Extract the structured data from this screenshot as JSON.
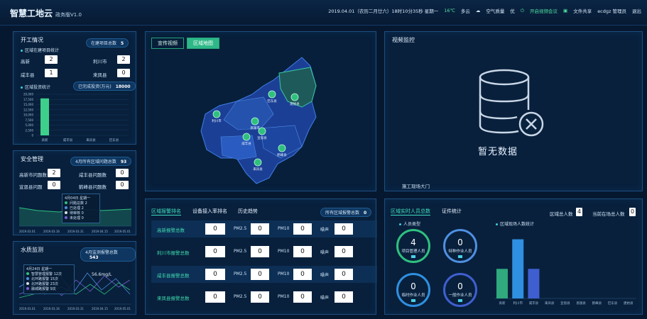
{
  "header": {
    "brand": "智慧工地云",
    "version": "政务版V1.0",
    "datetime": "2019.04.01（农历二月廿六）18时10分35秒 星期一",
    "temperature": "16℃",
    "weather": "多云",
    "air_label": "空气质量",
    "air_value": "优",
    "video_meeting": "开启视频会议",
    "file_share": "文件共享",
    "user": "ecdgz 管理员",
    "logout": "退出"
  },
  "kaigong": {
    "title": "开工情况",
    "badge_label": "在建项目总数",
    "badge_value": "5",
    "sub1": "区域在建项目统计",
    "items": [
      {
        "label": "高新",
        "value": "2"
      },
      {
        "label": "利川市",
        "value": "2"
      },
      {
        "label": "咸丰县",
        "value": "1"
      },
      {
        "label": "来凤县",
        "value": "0"
      }
    ],
    "sub2": "区域投资统计",
    "invest_label": "已完成投资(万元)",
    "invest_value": "18000"
  },
  "invest_chart": {
    "type": "bar",
    "categories": [
      "高新",
      "咸丰县",
      "来凤县",
      "巴东县"
    ],
    "values": [
      18000,
      0,
      0,
      0
    ],
    "ylim": [
      0,
      20000
    ],
    "yticks": [
      "20,000",
      "17,500",
      "15,000",
      "12,500",
      "10,000",
      "7,500",
      "5,000",
      "2,500",
      "0"
    ]
  },
  "safety": {
    "title": "安全管理",
    "badge_label": "4月所有区域问题总数",
    "badge_value": "93",
    "items": [
      {
        "label": "高新市问题数",
        "value": "2"
      },
      {
        "label": "咸丰县问题数",
        "value": "0"
      },
      {
        "label": "宣恩县问题",
        "value": "0"
      },
      {
        "label": "鹤峰县问题数",
        "value": "0"
      }
    ],
    "tooltip": {
      "title": "4月04日 星期一",
      "rows": [
        {
          "label": "问题总数",
          "value": "2",
          "color": "#2fc07e"
        },
        {
          "label": "已处理",
          "value": "2",
          "color": "#4f8fe0"
        },
        {
          "label": "待审核",
          "value": "0",
          "color": "#d8dbe6"
        },
        {
          "label": "未处理",
          "value": "0",
          "color": "#7a5fd8"
        }
      ]
    },
    "dates": [
      "2019.03.01",
      "2019.03.16",
      "2019.03.31",
      "2019.04.15",
      "2019.05.01"
    ]
  },
  "water": {
    "title": "水质监测",
    "badge_label": "4月监测报警总数",
    "badge_value": "543",
    "tooltip": {
      "title": "4月24日 星期一",
      "rows": [
        {
          "label": "智慧管理报警",
          "value": "12次",
          "color": "#2fc07e"
        },
        {
          "label": "北环路报警",
          "value": "15次",
          "color": "#4f8fe0"
        },
        {
          "label": "北环路报警",
          "value": "23次",
          "color": "#d8dbe6"
        },
        {
          "label": "融城路报警",
          "value": "9次",
          "color": "#7a5fd8"
        }
      ]
    },
    "value_label": "56.6mg/L",
    "dates": [
      "2019.03.01",
      "2019.03.16",
      "2019.03.31",
      "2019.04.15",
      "2019.05.01"
    ]
  },
  "map": {
    "tab1": "宣传视频",
    "tab2": "区域地图",
    "pins": [
      "利川市",
      "恩施市",
      "巴东县",
      "建始县",
      "咸丰县",
      "宣恩县",
      "鹤峰县",
      "来凤县"
    ]
  },
  "video": {
    "title": "视频监控",
    "no_data": "暂无数据",
    "gate": "施工现场大门"
  },
  "alarm": {
    "tab1": "区域报警排名",
    "tab2": "设备接入率排名",
    "tab3": "历史趋势",
    "badge_label": "所有区域报警总数",
    "badge_value": "0",
    "rows": [
      {
        "name": "高新报警总数",
        "total": "0",
        "pm25": "0",
        "pm10": "0",
        "noise": "0"
      },
      {
        "name": "利川市报警总数",
        "total": "0",
        "pm25": "0",
        "pm10": "0",
        "noise": "0"
      },
      {
        "name": "咸丰县报警总数",
        "total": "0",
        "pm25": "0",
        "pm10": "0",
        "noise": "0"
      },
      {
        "name": "来凤县报警总数",
        "total": "0",
        "pm25": "0",
        "pm10": "0",
        "noise": "0"
      }
    ],
    "pm25_label": "PM2.5",
    "pm10_label": "PM10",
    "noise_label": "噪声"
  },
  "people": {
    "tab1": "区域实时人员总数",
    "tab2": "证件统计",
    "region_label": "区域总人数",
    "region_value": "4",
    "current_label": "当前在场总人数",
    "current_value": "0",
    "sub1": "人员类型",
    "sub2": "区域现场人数统计",
    "circles": [
      {
        "value": "4",
        "label": "项目管理人员"
      },
      {
        "value": "0",
        "label": "特种作业人员"
      },
      {
        "value": "0",
        "label": "临时作业人员"
      },
      {
        "value": "0",
        "label": "一般作业人员"
      }
    ]
  },
  "people_chart": {
    "type": "bar",
    "categories": [
      "高新",
      "利川市",
      "咸丰县",
      "来凤县",
      "宣恩县",
      "恩施县",
      "鹤峰县",
      "巴东县",
      "建始县"
    ],
    "values": [
      1,
      2,
      1,
      0,
      0,
      0,
      0,
      0,
      0
    ],
    "colors": [
      "#2fa97d",
      "#2f8fe0",
      "#3f5fd0"
    ],
    "ylim": [
      0,
      2.3
    ]
  },
  "colors": {
    "bg": "#061830",
    "panel": "#09223e",
    "accent": "#3fe0c0",
    "border": "#1d4e7e"
  }
}
